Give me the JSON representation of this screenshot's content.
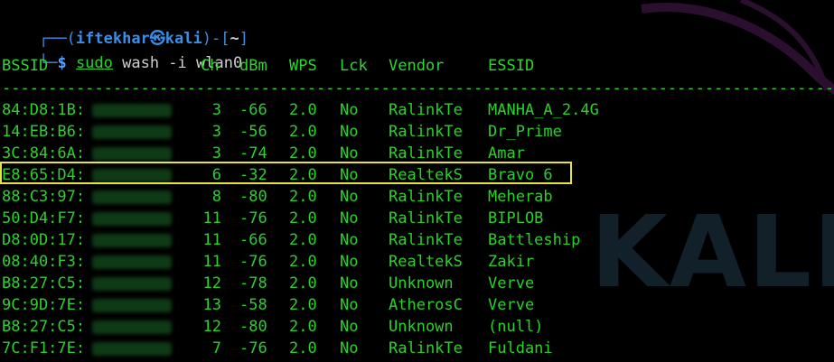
{
  "prompt": {
    "corner_top": "┌──(",
    "user": "iftekhar",
    "at": "㉿",
    "host": "kali",
    "mid": ")-[",
    "dir": "~",
    "end": "]",
    "corner_bottom": "└─",
    "dollar": "$",
    "cmd_sudo": "sudo",
    "cmd_rest": " wash -i wlan0"
  },
  "table": {
    "headers": [
      "BSSID",
      "Ch",
      "dBm",
      "WPS",
      "Lck",
      "Vendor",
      "ESSID"
    ],
    "separator": "------------------------------------------------------------------------------------------",
    "rows": [
      [
        "84:D8:1B:",
        "3",
        "-66",
        "2.0",
        "No",
        "RalinkTe",
        "MANHA_A_2.4G"
      ],
      [
        "14:EB:B6:",
        "3",
        "-56",
        "2.0",
        "No",
        "RalinkTe",
        "Dr_Prime"
      ],
      [
        "3C:84:6A:",
        "3",
        "-74",
        "2.0",
        "No",
        "RalinkTe",
        "Amar"
      ],
      [
        "E8:65:D4:",
        "6",
        "-32",
        "2.0",
        "No",
        "RealtekS",
        "Bravo 6"
      ],
      [
        "88:C3:97:",
        "8",
        "-80",
        "2.0",
        "No",
        "RalinkTe",
        "Meherab"
      ],
      [
        "50:D4:F7:",
        "11",
        "-76",
        "2.0",
        "No",
        "RalinkTe",
        "BIPLOB"
      ],
      [
        "D8:0D:17:",
        "11",
        "-66",
        "2.0",
        "No",
        "RalinkTe",
        "Battleship"
      ],
      [
        "08:40:F3:",
        "11",
        "-76",
        "2.0",
        "No",
        "RealtekS",
        "Zakir"
      ],
      [
        "B8:27:C5:",
        "12",
        "-78",
        "2.0",
        "No",
        "Unknown",
        "Verve"
      ],
      [
        "9C:9D:7E:",
        "13",
        "-58",
        "2.0",
        "No",
        "AtherosC",
        "Verve"
      ],
      [
        "B8:27:C5:",
        "12",
        "-80",
        "2.0",
        "No",
        "Unknown",
        "(null)"
      ],
      [
        "7C:F1:7E:",
        "7",
        "-76",
        "2.0",
        "No",
        "RalinkTe",
        "Fuldani"
      ]
    ],
    "highlighted_row": 3
  },
  "watermark": "KALI",
  "colors": {
    "background": "#000000",
    "text_green": "#28d228",
    "prompt_blue": "#3a8ee6",
    "highlight": "#e9e43b"
  }
}
